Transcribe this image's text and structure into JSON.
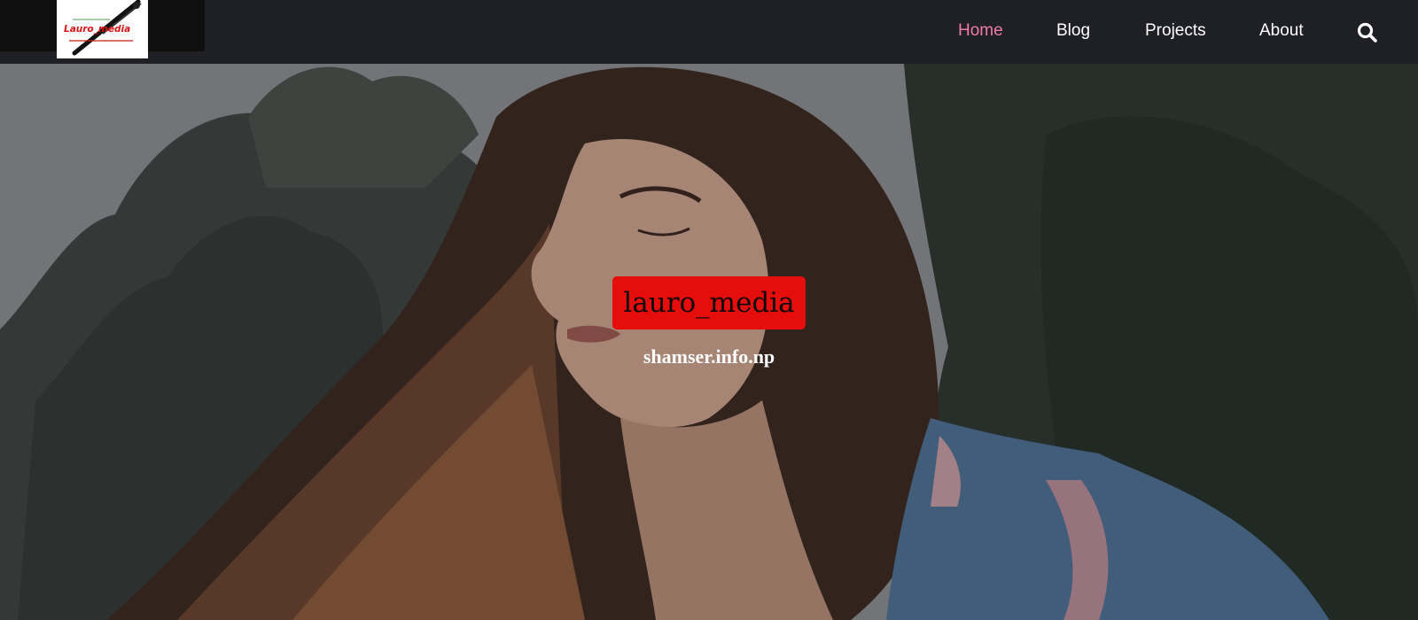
{
  "header": {
    "logo": {
      "brand_text": "Lauro_media",
      "icon": "pen-icon"
    },
    "nav": [
      {
        "label": "Home",
        "active": true
      },
      {
        "label": "Blog",
        "active": false
      },
      {
        "label": "Projects",
        "active": false
      },
      {
        "label": "About",
        "active": false
      }
    ],
    "search_icon": "search-icon",
    "active_color": "#f27ba6"
  },
  "hero": {
    "title": "lauro_media",
    "subtitle": "shamser.info.np",
    "title_bg_color": "#e60d0d"
  }
}
